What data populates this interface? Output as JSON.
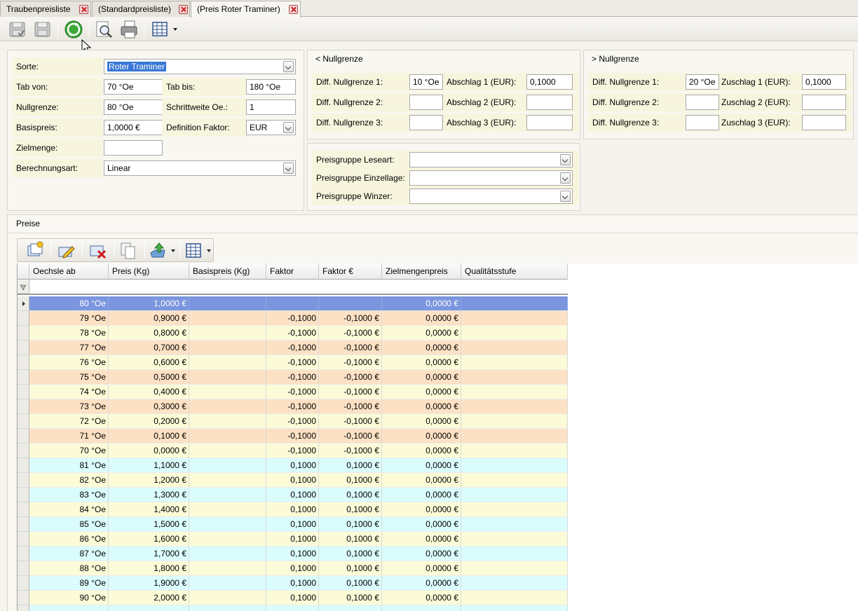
{
  "tabs": [
    {
      "label": "Traubenpreisliste"
    },
    {
      "label": "(Standardpreisliste)"
    },
    {
      "label": "(Preis Roter Traminer)"
    }
  ],
  "form": {
    "sorte_label": "Sorte:",
    "sorte_value": "Roter Traminer",
    "tab_von_label": "Tab von:",
    "tab_von_value": "70 °Oe",
    "tab_bis_label": "Tab bis:",
    "tab_bis_value": "180 °Oe",
    "nullgrenze_label": "Nullgrenze:",
    "nullgrenze_value": "80 °Oe",
    "schrittweite_label": "Schrittweite Oe.:",
    "schrittweite_value": "1",
    "basispreis_label": "Basispreis:",
    "basispreis_value": "1,0000 €",
    "definition_faktor_label": "Definition Faktor:",
    "definition_faktor_value": "EUR",
    "zielmenge_label": "Zielmenge:",
    "zielmenge_value": "",
    "berechnungsart_label": "Berechnungsart:",
    "berechnungsart_value": "Linear"
  },
  "lower_group": {
    "title": "< Nullgrenze",
    "diff1_label": "Diff. Nullgrenze 1:",
    "diff1_value": "10 °Oe",
    "diff2_label": "Diff. Nullgrenze 2:",
    "diff2_value": "",
    "diff3_label": "Diff. Nullgrenze 3:",
    "diff3_value": "",
    "adj1_label": "Abschlag 1 (EUR):",
    "adj1_value": "0,1000",
    "adj2_label": "Abschlag 2 (EUR):",
    "adj2_value": "",
    "adj3_label": "Abschlag 3 (EUR):",
    "adj3_value": ""
  },
  "upper_group": {
    "title": "> Nullgrenze",
    "diff1_label": "Diff. Nullgrenze 1:",
    "diff1_value": "20 °Oe",
    "diff2_label": "Diff. Nullgrenze 2:",
    "diff2_value": "",
    "diff3_label": "Diff. Nullgrenze 3:",
    "diff3_value": "",
    "adj1_label": "Zuschlag 1 (EUR):",
    "adj1_value": "0,1000",
    "adj2_label": "Zuschlag 2 (EUR):",
    "adj2_value": "",
    "adj3_label": "Zuschlag 3 (EUR):",
    "adj3_value": ""
  },
  "preisgruppen": {
    "leseart_label": "Preisgruppe Leseart:",
    "leseart_value": "",
    "einzellage_label": "Preisgruppe Einzellage:",
    "einzellage_value": "",
    "winzer_label": "Preisgruppe Winzer:",
    "winzer_value": ""
  },
  "preise": {
    "title": "Preise",
    "columns": [
      "Oechsle ab",
      "Preis (Kg)",
      "Basispreis (Kg)",
      "Faktor",
      "Faktor €",
      "Zielmengenpreis",
      "Qualitätsstufe"
    ],
    "rows": [
      {
        "oechsle": "80 °Oe",
        "preis": "1,0000 €",
        "basispreis": "",
        "faktor": "",
        "faktor_eur": "",
        "zielmengenpreis": "0,0000 €",
        "qualitaet": "",
        "band": "selected"
      },
      {
        "oechsle": "79 °Oe",
        "preis": "0,9000 €",
        "basispreis": "",
        "faktor": "-0,1000",
        "faktor_eur": "-0,1000 €",
        "zielmengenpreis": "0,0000 €",
        "qualitaet": "",
        "band": "orange"
      },
      {
        "oechsle": "78 °Oe",
        "preis": "0,8000 €",
        "basispreis": "",
        "faktor": "-0,1000",
        "faktor_eur": "-0,1000 €",
        "zielmengenpreis": "0,0000 €",
        "qualitaet": "",
        "band": "yellow"
      },
      {
        "oechsle": "77 °Oe",
        "preis": "0,7000 €",
        "basispreis": "",
        "faktor": "-0,1000",
        "faktor_eur": "-0,1000 €",
        "zielmengenpreis": "0,0000 €",
        "qualitaet": "",
        "band": "orange"
      },
      {
        "oechsle": "76 °Oe",
        "preis": "0,6000 €",
        "basispreis": "",
        "faktor": "-0,1000",
        "faktor_eur": "-0,1000 €",
        "zielmengenpreis": "0,0000 €",
        "qualitaet": "",
        "band": "yellow"
      },
      {
        "oechsle": "75 °Oe",
        "preis": "0,5000 €",
        "basispreis": "",
        "faktor": "-0,1000",
        "faktor_eur": "-0,1000 €",
        "zielmengenpreis": "0,0000 €",
        "qualitaet": "",
        "band": "orange"
      },
      {
        "oechsle": "74 °Oe",
        "preis": "0,4000 €",
        "basispreis": "",
        "faktor": "-0,1000",
        "faktor_eur": "-0,1000 €",
        "zielmengenpreis": "0,0000 €",
        "qualitaet": "",
        "band": "yellow"
      },
      {
        "oechsle": "73 °Oe",
        "preis": "0,3000 €",
        "basispreis": "",
        "faktor": "-0,1000",
        "faktor_eur": "-0,1000 €",
        "zielmengenpreis": "0,0000 €",
        "qualitaet": "",
        "band": "orange"
      },
      {
        "oechsle": "72 °Oe",
        "preis": "0,2000 €",
        "basispreis": "",
        "faktor": "-0,1000",
        "faktor_eur": "-0,1000 €",
        "zielmengenpreis": "0,0000 €",
        "qualitaet": "",
        "band": "yellow"
      },
      {
        "oechsle": "71 °Oe",
        "preis": "0,1000 €",
        "basispreis": "",
        "faktor": "-0,1000",
        "faktor_eur": "-0,1000 €",
        "zielmengenpreis": "0,0000 €",
        "qualitaet": "",
        "band": "orange"
      },
      {
        "oechsle": "70 °Oe",
        "preis": "0,0000 €",
        "basispreis": "",
        "faktor": "-0,1000",
        "faktor_eur": "-0,1000 €",
        "zielmengenpreis": "0,0000 €",
        "qualitaet": "",
        "band": "yellow"
      },
      {
        "oechsle": "81 °Oe",
        "preis": "1,1000 €",
        "basispreis": "",
        "faktor": "0,1000",
        "faktor_eur": "0,1000 €",
        "zielmengenpreis": "0,0000 €",
        "qualitaet": "",
        "band": "cyan"
      },
      {
        "oechsle": "82 °Oe",
        "preis": "1,2000 €",
        "basispreis": "",
        "faktor": "0,1000",
        "faktor_eur": "0,1000 €",
        "zielmengenpreis": "0,0000 €",
        "qualitaet": "",
        "band": "yellow"
      },
      {
        "oechsle": "83 °Oe",
        "preis": "1,3000 €",
        "basispreis": "",
        "faktor": "0,1000",
        "faktor_eur": "0,1000 €",
        "zielmengenpreis": "0,0000 €",
        "qualitaet": "",
        "band": "cyan"
      },
      {
        "oechsle": "84 °Oe",
        "preis": "1,4000 €",
        "basispreis": "",
        "faktor": "0,1000",
        "faktor_eur": "0,1000 €",
        "zielmengenpreis": "0,0000 €",
        "qualitaet": "",
        "band": "yellow"
      },
      {
        "oechsle": "85 °Oe",
        "preis": "1,5000 €",
        "basispreis": "",
        "faktor": "0,1000",
        "faktor_eur": "0,1000 €",
        "zielmengenpreis": "0,0000 €",
        "qualitaet": "",
        "band": "cyan"
      },
      {
        "oechsle": "86 °Oe",
        "preis": "1,6000 €",
        "basispreis": "",
        "faktor": "0,1000",
        "faktor_eur": "0,1000 €",
        "zielmengenpreis": "0,0000 €",
        "qualitaet": "",
        "band": "yellow"
      },
      {
        "oechsle": "87 °Oe",
        "preis": "1,7000 €",
        "basispreis": "",
        "faktor": "0,1000",
        "faktor_eur": "0,1000 €",
        "zielmengenpreis": "0,0000 €",
        "qualitaet": "",
        "band": "cyan"
      },
      {
        "oechsle": "88 °Oe",
        "preis": "1,8000 €",
        "basispreis": "",
        "faktor": "0,1000",
        "faktor_eur": "0,1000 €",
        "zielmengenpreis": "0,0000 €",
        "qualitaet": "",
        "band": "yellow"
      },
      {
        "oechsle": "89 °Oe",
        "preis": "1,9000 €",
        "basispreis": "",
        "faktor": "0,1000",
        "faktor_eur": "0,1000 €",
        "zielmengenpreis": "0,0000 €",
        "qualitaet": "",
        "band": "cyan"
      },
      {
        "oechsle": "90 °Oe",
        "preis": "2,0000 €",
        "basispreis": "",
        "faktor": "0,1000",
        "faktor_eur": "0,1000 €",
        "zielmengenpreis": "0,0000 €",
        "qualitaet": "",
        "band": "yellow"
      },
      {
        "oechsle": "",
        "preis": "",
        "basispreis": "",
        "faktor": "",
        "faktor_eur": "",
        "zielmengenpreis": "",
        "qualitaet": "",
        "band": "cyan"
      }
    ]
  },
  "colors": {
    "selected": "#7b96de",
    "orange": "#fde1c4",
    "yellow": "#fbfbd8",
    "cyan": "#dbfcfd",
    "label_bg": "#f7f5dd"
  },
  "icons": {
    "toolbar": [
      "save-disabled-icon",
      "save-icon",
      "refresh-icon",
      "print-preview-icon",
      "print-icon",
      "grid-layout-icon"
    ],
    "grid_toolbar": [
      "new-record-icon",
      "edit-icon",
      "delete-icon",
      "copy-icon",
      "export-icon",
      "grid-layout-icon"
    ]
  }
}
